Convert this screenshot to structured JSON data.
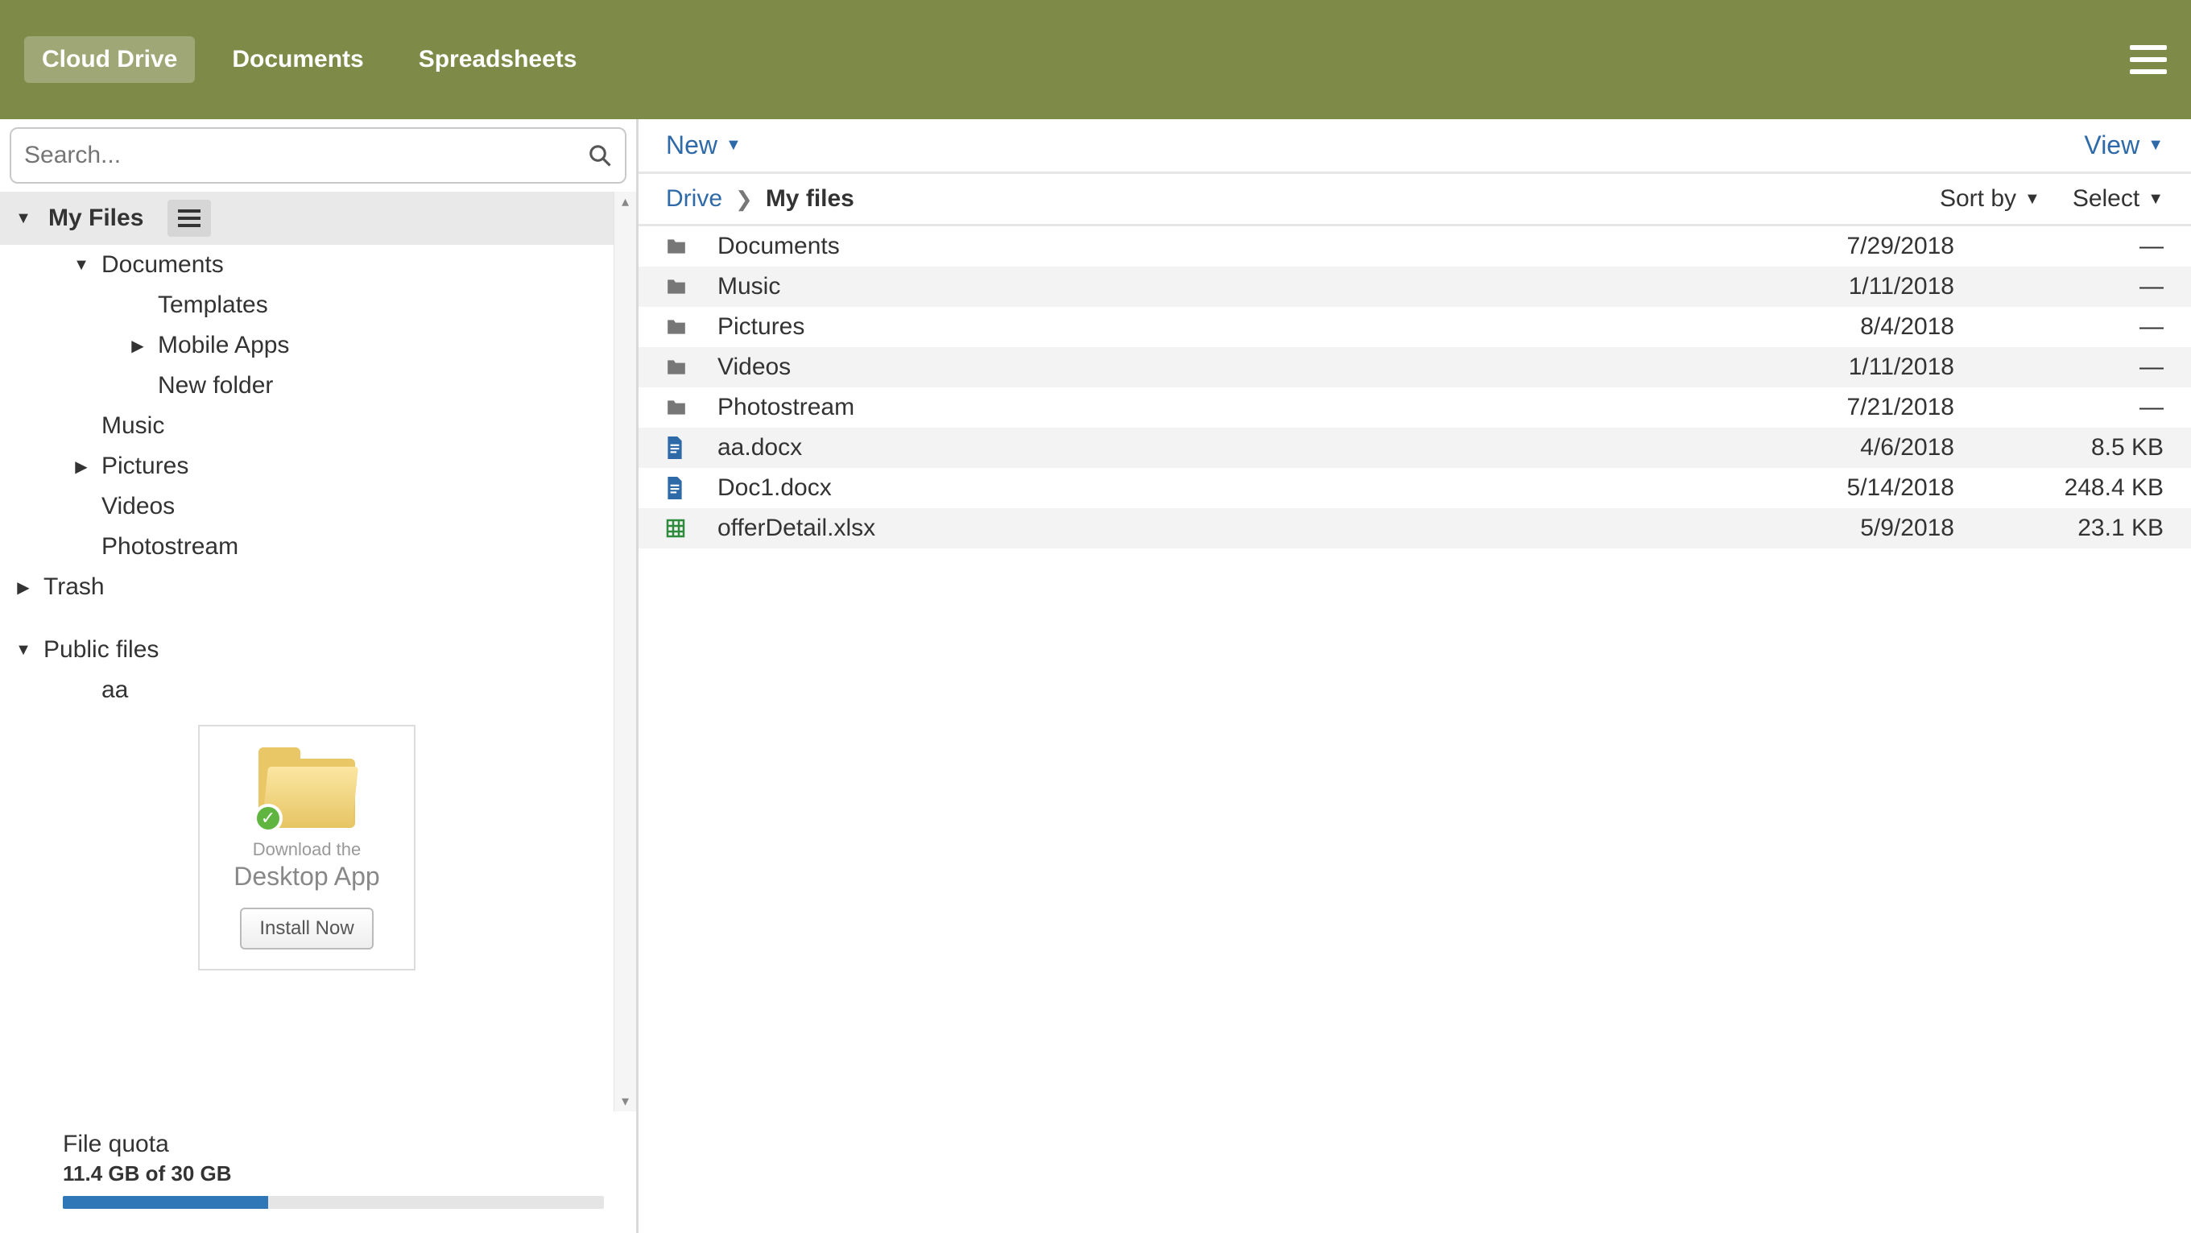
{
  "header": {
    "tabs": [
      {
        "label": "Cloud Drive",
        "active": true
      },
      {
        "label": "Documents",
        "active": false
      },
      {
        "label": "Spreadsheets",
        "active": false
      }
    ]
  },
  "sidebar": {
    "search_placeholder": "Search...",
    "root_label": "My Files",
    "tree": {
      "documents": "Documents",
      "templates": "Templates",
      "mobile_apps": "Mobile Apps",
      "new_folder": "New folder",
      "music": "Music",
      "pictures": "Pictures",
      "videos": "Videos",
      "photostream": "Photostream",
      "trash": "Trash",
      "public_files": "Public files",
      "aa": "aa"
    },
    "promo": {
      "line1": "Download the",
      "line2": "Desktop App",
      "button": "Install Now"
    },
    "quota": {
      "label": "File quota",
      "value": "11.4 GB of 30 GB",
      "percent": 38
    }
  },
  "toolbar": {
    "new_label": "New",
    "view_label": "View"
  },
  "breadcrumb": {
    "root": "Drive",
    "current": "My files"
  },
  "subbar": {
    "sort_label": "Sort by",
    "select_label": "Select"
  },
  "files": [
    {
      "type": "folder",
      "name": "Documents",
      "date": "7/29/2018",
      "size": "—"
    },
    {
      "type": "folder",
      "name": "Music",
      "date": "1/11/2018",
      "size": "—"
    },
    {
      "type": "folder",
      "name": "Pictures",
      "date": "8/4/2018",
      "size": "—"
    },
    {
      "type": "folder",
      "name": "Videos",
      "date": "1/11/2018",
      "size": "—"
    },
    {
      "type": "folder",
      "name": "Photostream",
      "date": "7/21/2018",
      "size": "—"
    },
    {
      "type": "doc",
      "name": "aa.docx",
      "date": "4/6/2018",
      "size": "8.5 KB"
    },
    {
      "type": "doc",
      "name": "Doc1.docx",
      "date": "5/14/2018",
      "size": "248.4 KB"
    },
    {
      "type": "sheet",
      "name": "offerDetail.xlsx",
      "date": "5/9/2018",
      "size": "23.1 KB"
    }
  ]
}
